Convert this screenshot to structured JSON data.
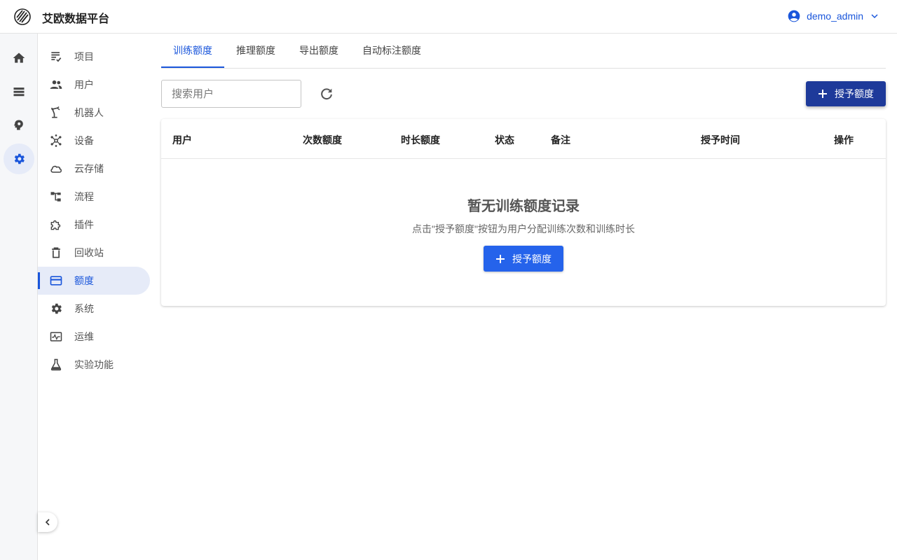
{
  "app": {
    "title": "艾欧数据平台"
  },
  "user": {
    "name": "demo_admin"
  },
  "rail": [
    "home-icon",
    "storage-icon",
    "brain-icon",
    "settings-icon"
  ],
  "sidebar": {
    "items": [
      {
        "label": "项目",
        "icon": "project-list-icon"
      },
      {
        "label": "用户",
        "icon": "users-icon"
      },
      {
        "label": "机器人",
        "icon": "robot-arm-icon"
      },
      {
        "label": "设备",
        "icon": "device-hub-icon"
      },
      {
        "label": "云存储",
        "icon": "cloud-icon"
      },
      {
        "label": "流程",
        "icon": "workflow-icon"
      },
      {
        "label": "插件",
        "icon": "puzzle-icon"
      },
      {
        "label": "回收站",
        "icon": "trash-icon"
      },
      {
        "label": "额度",
        "icon": "credit-card-icon",
        "active": true
      },
      {
        "label": "系统",
        "icon": "gear-icon"
      },
      {
        "label": "运维",
        "icon": "monitor-icon"
      },
      {
        "label": "实验功能",
        "icon": "flask-icon"
      }
    ]
  },
  "tabs": [
    {
      "label": "训练额度",
      "active": true
    },
    {
      "label": "推理额度"
    },
    {
      "label": "导出额度"
    },
    {
      "label": "自动标注额度"
    }
  ],
  "toolbar": {
    "search_placeholder": "搜索用户",
    "grant_label": "授予额度"
  },
  "table": {
    "columns": [
      "用户",
      "次数额度",
      "时长额度",
      "状态",
      "备注",
      "授予时间",
      "操作"
    ]
  },
  "empty": {
    "title": "暂无训练额度记录",
    "description": "点击\"授予额度\"按钮为用户分配训练次数和训练时长",
    "button_label": "授予额度"
  },
  "colors": {
    "accent": "#1a56db",
    "primary_button": "#2563eb",
    "header_button": "#1e3a9a",
    "active_bg": "#e6ebf8"
  }
}
